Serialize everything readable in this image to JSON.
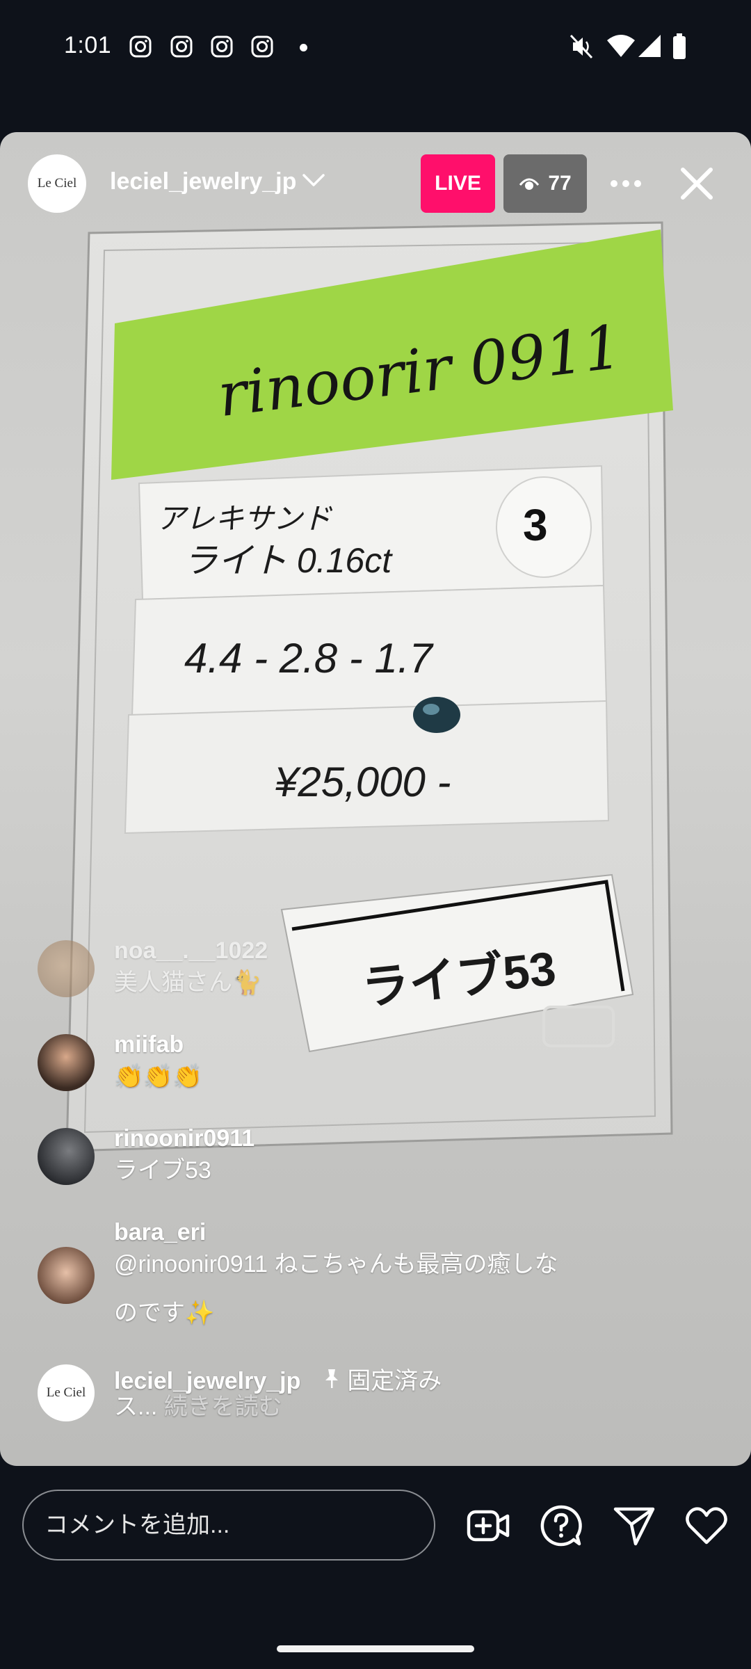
{
  "status_bar": {
    "time": "1:01",
    "notification_icons": [
      "instagram-icon",
      "instagram-icon",
      "instagram-icon",
      "instagram-icon"
    ],
    "system_icons": [
      "mute-icon",
      "wifi-icon",
      "signal-icon",
      "battery-icon"
    ]
  },
  "live": {
    "host_username": "leciel_jewelry_jp",
    "host_avatar_text": "Le Ciel",
    "live_label": "LIVE",
    "viewer_count": "77",
    "accent_color": "#ff0f6b"
  },
  "video_content": {
    "sticky_note": "rinoorir 0911",
    "line1_top": "アレキサンド",
    "line1_bottom": "ライト 0.16ct",
    "badge_number": "3",
    "dimensions": "4.4 - 2.8 - 1.7",
    "price": "¥25,000 -",
    "label_card": "ライブ53"
  },
  "comments": [
    {
      "username": "noa__.__1022",
      "text": "美人猫さん🐈",
      "faded": true
    },
    {
      "username": "miifab",
      "text": "👏👏👏"
    },
    {
      "username": "rinoonir0911",
      "text": "ライブ53"
    },
    {
      "username": "bara_eri",
      "text_line1": "@rinoonir0911 ねこちゃんも最高の癒しな",
      "text_line2": "のです✨"
    },
    {
      "username": "leciel_jewelry_jp",
      "pinned_label": "固定済み",
      "text": "ス...",
      "more_label": "続きを読む",
      "avatar_text": "Le Ciel"
    }
  ],
  "bottom_bar": {
    "comment_placeholder": "コメントを追加...",
    "icons": [
      "add-video-icon",
      "question-icon",
      "send-icon",
      "heart-icon"
    ]
  }
}
